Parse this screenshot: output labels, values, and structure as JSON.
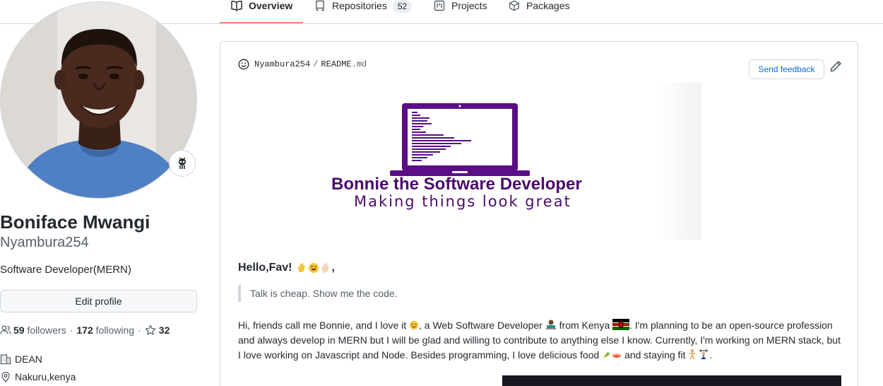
{
  "tabs": [
    {
      "label": "Overview",
      "icon": "book-icon",
      "active": true
    },
    {
      "label": "Repositories",
      "icon": "repo-icon",
      "count": "52"
    },
    {
      "label": "Projects",
      "icon": "project-icon"
    },
    {
      "label": "Packages",
      "icon": "package-icon"
    }
  ],
  "profile": {
    "full_name": "Boniface Mwangi",
    "username": "Nyambura254",
    "bio": "Software Developer(MERN)",
    "edit_label": "Edit profile",
    "followers_count": "59",
    "followers_label": "followers",
    "following_count": "172",
    "following_label": "following",
    "stars_count": "32",
    "organization": "DEAN",
    "location": "Nakuru,kenya"
  },
  "readme": {
    "owner": "Nyambura254",
    "file": "README",
    "ext": ".md",
    "feedback_label": "Send feedback",
    "banner_title": "Bonnie the Software Developer",
    "banner_subtitle": "Making things look great",
    "greeting": "Hello,Fav!",
    "greeting_suffix": ",",
    "quote": "Talk is cheap. Show me the code.",
    "para_1": "Hi, friends call me Bonnie, and I love it",
    "para_2": ", a Web Software Developer",
    "para_3": "from Kenya",
    "para_4": ". I'm planning to be an open-source profession and always develop in MERN but I will be glad and willing to contribute to anything else I know. Currently, I'm working on MERN stack, but I love working on Javascript and Node. Besides programming, I love delicious food",
    "para_5": "and staying fit",
    "para_6": "."
  },
  "colors": {
    "accent": "#fd8c73",
    "link": "#0969da",
    "banner_purple": "#4b0a6b"
  }
}
